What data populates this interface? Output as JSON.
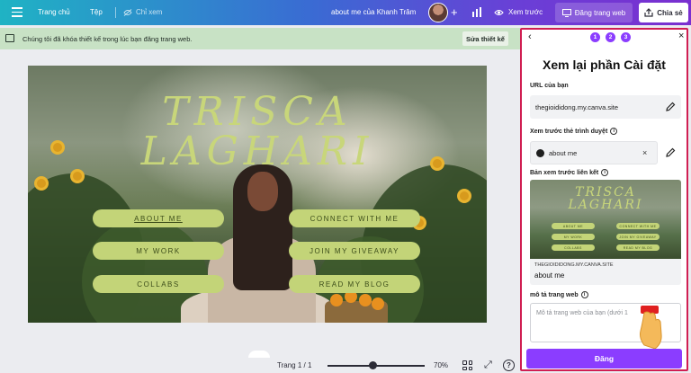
{
  "topbar": {
    "home": "Trang chủ",
    "file": "Tệp",
    "view_only": "Chỉ xem",
    "doc_title": "about me của Khanh Trâm",
    "preview": "Xem trước",
    "publish": "Đăng trang web",
    "share": "Chia sẻ"
  },
  "notice": {
    "text": "Chúng tôi đã khóa thiết kế trong lúc bạn đăng trang web.",
    "button": "Sửa thiết kế"
  },
  "canvas": {
    "title_line1": "TRISCA",
    "title_line2": "LAGHARI",
    "buttons": {
      "about": "ABOUT ME",
      "work": "MY WORK",
      "collabs": "COLLABS",
      "connect": "CONNECT WITH ME",
      "giveaway": "JOIN MY GIVEAWAY",
      "blog": "READ MY BLOG"
    }
  },
  "bottombar": {
    "page": "Trang 1 / 1",
    "zoom": "70%",
    "zoom_fraction": 0.47,
    "help": "?"
  },
  "panel": {
    "steps": [
      "1",
      "2",
      "3"
    ],
    "title": "Xem lại phần Cài đặt",
    "url_label": "URL của bạn",
    "url_value": "thegioididong.my.canva.site",
    "browser_label": "Xem trước thẻ trình duyệt",
    "tab_value": "about me",
    "link_label": "Bản xem trước liên kết",
    "thumb_title_line1": "TRISCA",
    "thumb_title_line2": "LAGHARI",
    "thumb_buttons": [
      "ABOUT ME",
      "CONNECT WITH ME",
      "MY WORK",
      "JOIN MY GIVEAWAY",
      "COLLABS",
      "READ MY BLOG"
    ],
    "link_domain": "THEGIOIDIDONG.MY.CANVA.SITE",
    "link_title": "about me",
    "desc_label": "mô tả trang web",
    "desc_placeholder": "Mô tả trang web của bạn (dưới 1",
    "publish_button": "Đăng"
  },
  "colors": {
    "accent": "#8b3dff",
    "panel_border": "#d01e52",
    "notice_bg": "#c8e2c5",
    "pill_green": "#c3d478"
  },
  "icons": [
    "menu-icon",
    "eye-off-icon",
    "avatar",
    "plus-icon",
    "chart-icon",
    "eye-icon",
    "share-icon",
    "lock-icon",
    "chevron-left-icon",
    "close-icon",
    "pencil-icon",
    "info-icon",
    "grid-icon",
    "fullscreen-icon",
    "help-icon",
    "hand-cursor-icon"
  ]
}
